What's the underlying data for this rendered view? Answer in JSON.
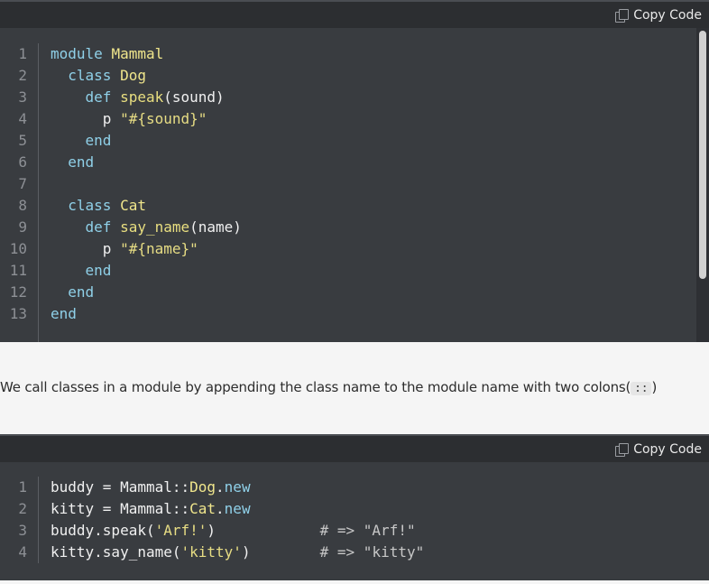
{
  "block1": {
    "copy_label": "Copy Code",
    "line_numbers": [
      "1",
      "2",
      "3",
      "4",
      "5",
      "6",
      "7",
      "8",
      "9",
      "10",
      "11",
      "12",
      "13"
    ],
    "lines": [
      [
        [
          "kw",
          "module "
        ],
        [
          "cn",
          "Mammal"
        ]
      ],
      [
        [
          "plain",
          "  "
        ],
        [
          "kw",
          "class "
        ],
        [
          "cn",
          "Dog"
        ]
      ],
      [
        [
          "plain",
          "    "
        ],
        [
          "kw",
          "def "
        ],
        [
          "fn",
          "speak"
        ],
        [
          "plain",
          "(sound)"
        ]
      ],
      [
        [
          "plain",
          "      p "
        ],
        [
          "str",
          "\"#{sound}\""
        ]
      ],
      [
        [
          "plain",
          "    "
        ],
        [
          "kw",
          "end"
        ]
      ],
      [
        [
          "plain",
          "  "
        ],
        [
          "kw",
          "end"
        ]
      ],
      [
        [
          "plain",
          ""
        ]
      ],
      [
        [
          "plain",
          "  "
        ],
        [
          "kw",
          "class "
        ],
        [
          "cn",
          "Cat"
        ]
      ],
      [
        [
          "plain",
          "    "
        ],
        [
          "kw",
          "def "
        ],
        [
          "fn",
          "say_name"
        ],
        [
          "plain",
          "(name)"
        ]
      ],
      [
        [
          "plain",
          "      p "
        ],
        [
          "str",
          "\"#{name}\""
        ]
      ],
      [
        [
          "plain",
          "    "
        ],
        [
          "kw",
          "end"
        ]
      ],
      [
        [
          "plain",
          "  "
        ],
        [
          "kw",
          "end"
        ]
      ],
      [
        [
          "kw",
          "end"
        ]
      ]
    ]
  },
  "prose": {
    "text": "We call classes in a module by appending the class name to the module name with two colons(",
    "code": "::",
    "after": ")"
  },
  "block2": {
    "copy_label": "Copy Code",
    "line_numbers": [
      "1",
      "2",
      "3",
      "4"
    ],
    "lines": [
      [
        [
          "plain",
          "buddy = Mammal::"
        ],
        [
          "cn",
          "Dog"
        ],
        [
          "plain",
          "."
        ],
        [
          "mt",
          "new"
        ]
      ],
      [
        [
          "plain",
          "kitty = Mammal::"
        ],
        [
          "cn",
          "Cat"
        ],
        [
          "plain",
          "."
        ],
        [
          "mt",
          "new"
        ]
      ],
      [
        [
          "plain",
          "buddy.speak("
        ],
        [
          "str",
          "'Arf!'"
        ],
        [
          "plain",
          ")            "
        ],
        [
          "cm",
          "# => \"Arf!\""
        ]
      ],
      [
        [
          "plain",
          "kitty.say_name("
        ],
        [
          "str",
          "'kitty'"
        ],
        [
          "plain",
          ")        "
        ],
        [
          "cm",
          "# => \"kitty\""
        ]
      ]
    ]
  },
  "colors": {
    "code_bg": "#393c40",
    "header_bg": "#2c2e31",
    "keyword": "#8fd0e8",
    "constant": "#f0e68c",
    "string": "#e7dd84",
    "page_bg": "#f5f5f5"
  }
}
